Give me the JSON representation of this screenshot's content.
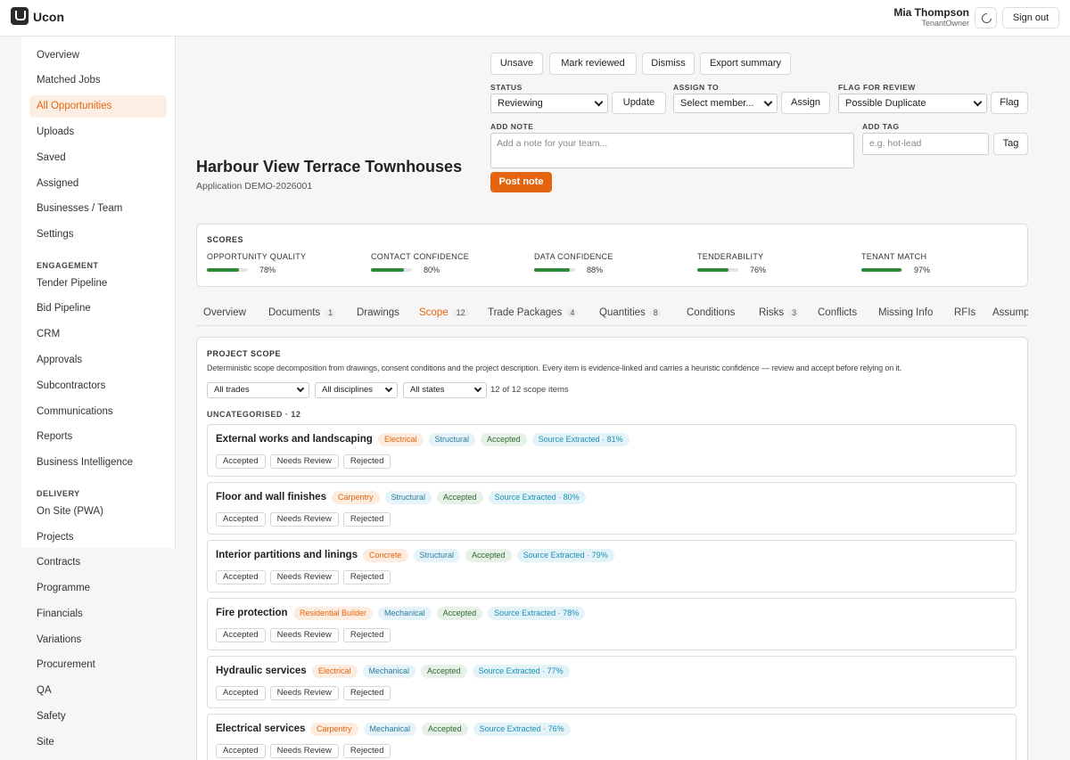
{
  "app": {
    "name": "Ucon"
  },
  "user": {
    "name": "Mia Thompson",
    "role": "TenantOwner",
    "signout_label": "Sign out"
  },
  "sidebar": {
    "items": [
      "Overview",
      "Matched Jobs",
      "All Opportunities",
      "Uploads",
      "Saved",
      "Assigned",
      "Businesses / Team",
      "Settings"
    ],
    "engagement_label": "ENGAGEMENT",
    "engagement": [
      "Tender Pipeline",
      "Bid Pipeline",
      "CRM",
      "Approvals",
      "Subcontractors",
      "Communications",
      "Reports",
      "Business Intelligence"
    ],
    "delivery_label": "DELIVERY",
    "delivery": [
      "On Site (PWA)",
      "Projects",
      "Contracts",
      "Programme",
      "Financials",
      "Variations",
      "Procurement",
      "QA",
      "Safety",
      "Site"
    ],
    "active": "All Opportunities"
  },
  "project": {
    "title": "Harbour View Terrace Townhouses",
    "subtitle": "Application DEMO-2026001"
  },
  "actions": {
    "unsave": "Unsave",
    "mark_reviewed": "Mark reviewed",
    "dismiss": "Dismiss",
    "export": "Export summary"
  },
  "status": {
    "label": "STATUS",
    "value": "Reviewing",
    "button": "Update"
  },
  "assign": {
    "label": "ASSIGN TO",
    "value": "Select member...",
    "button": "Assign"
  },
  "flag": {
    "label": "FLAG FOR REVIEW",
    "value": "Possible Duplicate",
    "button": "Flag"
  },
  "note": {
    "label": "ADD NOTE",
    "placeholder": "Add a note for your team...",
    "button": "Post note"
  },
  "tag": {
    "label": "ADD TAG",
    "placeholder": "e.g. hot-lead",
    "button": "Tag"
  },
  "scores": {
    "title": "SCORES",
    "items": [
      {
        "label": "OPPORTUNITY QUALITY",
        "value": 78,
        "display": "78%"
      },
      {
        "label": "CONTACT CONFIDENCE",
        "value": 80,
        "display": "80%"
      },
      {
        "label": "DATA CONFIDENCE",
        "value": 88,
        "display": "88%"
      },
      {
        "label": "TENDERABILITY",
        "value": 76,
        "display": "76%"
      },
      {
        "label": "TENANT MATCH",
        "value": 97,
        "display": "97%"
      }
    ]
  },
  "tabs": [
    {
      "label": "Overview",
      "count": ""
    },
    {
      "label": "Documents",
      "count": "1"
    },
    {
      "label": "Drawings",
      "count": ""
    },
    {
      "label": "Scope",
      "count": "12"
    },
    {
      "label": "Trade Packages",
      "count": "4"
    },
    {
      "label": "Quantities",
      "count": "8"
    },
    {
      "label": "Conditions",
      "count": ""
    },
    {
      "label": "Risks",
      "count": "3"
    },
    {
      "label": "Conflicts",
      "count": ""
    },
    {
      "label": "Missing Info",
      "count": ""
    },
    {
      "label": "RFIs",
      "count": ""
    },
    {
      "label": "Assump",
      "count": ""
    }
  ],
  "active_tab": "Scope",
  "scope": {
    "title": "PROJECT SCOPE",
    "description": "Deterministic scope decomposition from drawings, consent conditions and the project description. Every item is evidence-linked and carries a heuristic confidence — review and accept before relying on it.",
    "filters": {
      "trades": "All trades",
      "disciplines": "All disciplines",
      "states": "All states"
    },
    "count_text": "12 of 12 scope items",
    "group_label": "UNCATEGORISED · 12",
    "item_actions": [
      "Accepted",
      "Needs Review",
      "Rejected"
    ],
    "items": [
      {
        "title": "External works and landscaping",
        "trade": "Electrical",
        "discipline": "Structural",
        "status": "Accepted",
        "source": "Source Extracted · 81%"
      },
      {
        "title": "Floor and wall finishes",
        "trade": "Carpentry",
        "discipline": "Structural",
        "status": "Accepted",
        "source": "Source Extracted · 80%"
      },
      {
        "title": "Interior partitions and linings",
        "trade": "Concrete",
        "discipline": "Structural",
        "status": "Accepted",
        "source": "Source Extracted · 79%"
      },
      {
        "title": "Fire protection",
        "trade": "Residential Builder",
        "discipline": "Mechanical",
        "status": "Accepted",
        "source": "Source Extracted · 78%"
      },
      {
        "title": "Hydraulic services",
        "trade": "Electrical",
        "discipline": "Mechanical",
        "status": "Accepted",
        "source": "Source Extracted · 77%"
      },
      {
        "title": "Electrical services",
        "trade": "Carpentry",
        "discipline": "Mechanical",
        "status": "Accepted",
        "source": "Source Extracted · 76%"
      }
    ]
  }
}
